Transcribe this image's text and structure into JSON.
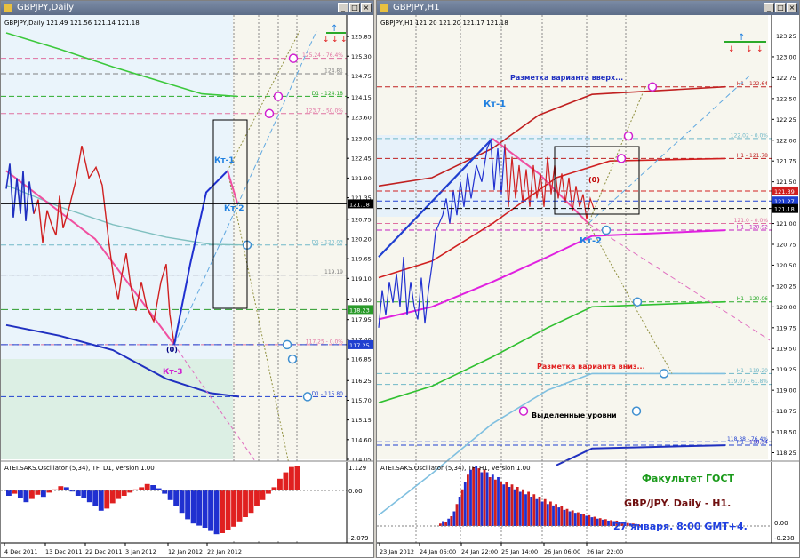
{
  "left_window": {
    "title": "GBPJPY,Daily",
    "header": "GBPJPY,Daily  121.49 121.56 121.14 121.18",
    "osc_label": "ATEI.SAKS.Oscillator (5,34), TF: D1, version 1.00",
    "osc_top": "1.129",
    "osc_mid": "0.00",
    "osc_bottom": "-2.079"
  },
  "right_window": {
    "title": "GBPJPY,H1",
    "header": "GBPJPY,H1  121.20 121.20 121.17 121.18",
    "osc_label": "ATEI.SAKS.Oscillator (5,34), TF: H1, version 1.00",
    "osc_mid": "0.00",
    "osc_bottom": "-0.238"
  },
  "window_buttons": {
    "min": "_",
    "max": "□",
    "close": "×"
  },
  "annotations": {
    "kt1": "Кт-1",
    "kt2": "Кт-2",
    "kt3": "Кт-3",
    "zero": "(0)",
    "up_variant": "Разметка варианта вверх...",
    "down_variant": "Разметка варианта вниз...",
    "levels": "Выделенные уровни",
    "faculty": "Факультет ГОСТ",
    "pair": "GBP/JPY. Daily - H1.",
    "date": "27 января. 8:00 GMT+4."
  },
  "chart_data": [
    {
      "type": "line",
      "title": "GBPJPY,Daily",
      "x_ticks": [
        "4 Dec 2011",
        "13 Dec 2011",
        "22 Dec 2011",
        "3 Jan 2012",
        "12 Jan 2012",
        "22 Jan 2012"
      ],
      "y_ticks": [
        "125.85",
        "125.30",
        "124.75",
        "124.15",
        "123.60",
        "123.00",
        "122.45",
        "121.90",
        "121.35",
        "120.75",
        "120.20",
        "119.65",
        "119.10",
        "118.50",
        "117.95",
        "117.40",
        "116.85",
        "116.25",
        "115.70",
        "115.15",
        "114.60",
        "114.05"
      ],
      "ylim": [
        114.05,
        126.05
      ],
      "current_price": "121.18",
      "price_badges": [
        {
          "label": "121.18",
          "value": 121.18,
          "color": "#000000"
        },
        {
          "label": "118.23",
          "value": 118.23,
          "color": "#2a9a2a"
        },
        {
          "label": "117.25",
          "value": 117.25,
          "color": "#2040d0"
        }
      ],
      "levels": [
        {
          "label": "125.24 - 76.4%",
          "value": 125.24,
          "color": "#e070a0"
        },
        {
          "label": "124.81",
          "value": 124.81,
          "color": "#808080"
        },
        {
          "label": "D1 - 124.18",
          "value": 124.18,
          "color": "#2aaa2a"
        },
        {
          "label": "123.7 - 50.0%",
          "value": 123.7,
          "color": "#e070a0"
        },
        {
          "label": "D1 - 120.03",
          "value": 120.03,
          "color": "#70b8c8"
        },
        {
          "label": "119.19",
          "value": 119.19,
          "color": "#808080"
        },
        {
          "label": "117.25 - 0.0%",
          "value": 117.25,
          "color": "#e070a0"
        },
        {
          "label": "D1 - 115.80",
          "value": 115.8,
          "color": "#2040d0"
        }
      ],
      "price_path": [
        [
          0,
          121.6
        ],
        [
          4,
          122.3
        ],
        [
          8,
          120.8
        ],
        [
          12,
          121.9
        ],
        [
          16,
          120.9
        ],
        [
          19,
          122.1
        ],
        [
          22,
          120.7
        ],
        [
          26,
          121.8
        ],
        [
          31,
          120.9
        ],
        [
          36,
          121.3
        ],
        [
          41,
          120.1
        ],
        [
          46,
          121.0
        ],
        [
          51,
          120.6
        ],
        [
          56,
          120.3
        ],
        [
          60,
          121.4
        ],
        [
          64,
          120.5
        ],
        [
          70,
          121.0
        ],
        [
          78,
          121.8
        ],
        [
          85,
          122.8
        ],
        [
          93,
          121.9
        ],
        [
          101,
          122.2
        ],
        [
          108,
          121.7
        ],
        [
          116,
          120.0
        ],
        [
          121,
          119.1
        ],
        [
          126,
          118.5
        ],
        [
          130,
          119.2
        ],
        [
          135,
          119.8
        ],
        [
          140,
          118.9
        ],
        [
          146,
          118.2
        ],
        [
          152,
          119.0
        ],
        [
          158,
          118.3
        ],
        [
          166,
          117.9
        ],
        [
          174,
          119.0
        ],
        [
          180,
          119.5
        ],
        [
          184,
          118.1
        ],
        [
          189,
          117.25
        ]
      ],
      "up_path": [
        [
          189,
          117.25
        ],
        [
          207,
          119.5
        ],
        [
          225,
          121.5
        ],
        [
          249,
          122.1
        ]
      ],
      "down_path": [
        [
          249,
          122.1
        ],
        [
          260,
          121.2
        ]
      ],
      "ma_green": [
        [
          0,
          125.95
        ],
        [
          60,
          125.5
        ],
        [
          120,
          125.0
        ],
        [
          180,
          124.55
        ],
        [
          220,
          124.25
        ],
        [
          260,
          124.18
        ]
      ],
      "ma_teal": [
        [
          0,
          121.7
        ],
        [
          60,
          121.1
        ],
        [
          120,
          120.6
        ],
        [
          180,
          120.25
        ],
        [
          230,
          120.05
        ],
        [
          275,
          120.03
        ]
      ],
      "ma_blue": [
        [
          0,
          117.8
        ],
        [
          60,
          117.5
        ],
        [
          120,
          117.1
        ],
        [
          180,
          116.3
        ],
        [
          230,
          115.9
        ],
        [
          262,
          115.8
        ]
      ],
      "osc_values": [
        -0.25,
        -0.15,
        -0.35,
        -0.55,
        -0.4,
        -0.2,
        -0.3,
        -0.1,
        0.05,
        0.2,
        0.15,
        -0.05,
        -0.25,
        -0.35,
        -0.55,
        -0.75,
        -0.95,
        -0.85,
        -0.6,
        -0.4,
        -0.25,
        -0.1,
        0.05,
        0.15,
        0.3,
        0.25,
        0.1,
        -0.15,
        -0.45,
        -0.75,
        -1.05,
        -1.35,
        -1.55,
        -1.65,
        -1.75,
        -1.9,
        -2.05,
        -2.0,
        -1.85,
        -1.7,
        -1.45,
        -1.25,
        -1.05,
        -0.75,
        -0.45,
        -0.15,
        0.15,
        0.55,
        0.85,
        1.1,
        1.129
      ]
    },
    {
      "type": "line",
      "title": "GBPJPY,H1",
      "x_ticks": [
        "23 Jan 2012",
        "24 Jan 06:00",
        "24 Jan 22:00",
        "25 Jan 14:00",
        "26 Jan 06:00",
        "26 Jan 22:00"
      ],
      "y_ticks": [
        "123.25",
        "123.00",
        "122.75",
        "122.50",
        "122.25",
        "122.00",
        "121.75",
        "121.50",
        "121.25",
        "121.00",
        "120.75",
        "120.50",
        "120.25",
        "120.00",
        "119.75",
        "119.50",
        "119.25",
        "119.00",
        "118.75",
        "118.50",
        "118.25"
      ],
      "ylim": [
        118.17,
        123.33
      ],
      "price_badges": [
        {
          "label": "121.39",
          "value": 121.39,
          "color": "#d02020"
        },
        {
          "label": "121.27",
          "value": 121.27,
          "color": "#2040d0"
        },
        {
          "label": "121.18",
          "value": 121.18,
          "color": "#000000"
        }
      ],
      "levels": [
        {
          "label": "H1 - 122.64",
          "value": 122.64,
          "color": "#c02020"
        },
        {
          "label": "122.02 - 0.0%",
          "value": 122.02,
          "color": "#70b8c8"
        },
        {
          "label": "H1 - 121.78",
          "value": 121.78,
          "color": "#c02020"
        },
        {
          "label": "121.0 - 0.0%",
          "value": 121.0,
          "color": "#e070a0"
        },
        {
          "label": "H1 - 120.92",
          "value": 120.92,
          "color": "#c020c0"
        },
        {
          "label": "H1 - 120.06",
          "value": 120.06,
          "color": "#2aaa2a"
        },
        {
          "label": "H1 - 119.20",
          "value": 119.2,
          "color": "#70b8c8"
        },
        {
          "label": "119.07 - 61.8%",
          "value": 119.07,
          "color": "#70b8c8"
        },
        {
          "label": "118.34",
          "value": 118.34,
          "color": "#c020c0"
        },
        {
          "label": "118.38 - 76.4%",
          "value": 118.38,
          "color": "#2040d0"
        },
        {
          "label": "H1 - 118.34",
          "value": 118.34,
          "color": "#2040d0"
        }
      ],
      "price_path": [
        [
          0,
          119.75
        ],
        [
          4,
          120.2
        ],
        [
          8,
          119.9
        ],
        [
          12,
          120.3
        ],
        [
          16,
          120.05
        ],
        [
          20,
          120.4
        ],
        [
          24,
          120.0
        ],
        [
          28,
          120.6
        ],
        [
          32,
          119.9
        ],
        [
          36,
          120.3
        ],
        [
          40,
          120.0
        ],
        [
          44,
          119.85
        ],
        [
          48,
          120.35
        ],
        [
          52,
          119.8
        ],
        [
          56,
          120.2
        ],
        [
          60,
          120.5
        ],
        [
          64,
          120.9
        ],
        [
          68,
          121.0
        ],
        [
          72,
          121.1
        ],
        [
          76,
          121.3
        ],
        [
          80,
          121.0
        ],
        [
          84,
          121.4
        ],
        [
          88,
          121.1
        ],
        [
          92,
          121.5
        ],
        [
          96,
          121.2
        ],
        [
          100,
          121.6
        ],
        [
          104,
          121.3
        ],
        [
          110,
          121.7
        ],
        [
          116,
          121.5
        ],
        [
          122,
          121.9
        ],
        [
          126,
          122.0
        ],
        [
          130,
          121.4
        ],
        [
          134,
          121.9
        ],
        [
          138,
          121.35
        ],
        [
          142,
          121.95
        ],
        [
          146,
          121.2
        ],
        [
          150,
          121.8
        ],
        [
          154,
          121.3
        ],
        [
          158,
          121.7
        ],
        [
          162,
          121.25
        ],
        [
          166,
          121.65
        ],
        [
          170,
          121.2
        ],
        [
          174,
          121.7
        ],
        [
          178,
          121.3
        ],
        [
          182,
          121.6
        ],
        [
          186,
          121.2
        ],
        [
          190,
          121.8
        ],
        [
          194,
          121.35
        ],
        [
          198,
          121.7
        ],
        [
          202,
          121.3
        ],
        [
          206,
          121.6
        ],
        [
          210,
          121.25
        ],
        [
          214,
          121.55
        ],
        [
          218,
          121.15
        ],
        [
          222,
          121.45
        ],
        [
          226,
          121.2
        ],
        [
          230,
          121.35
        ],
        [
          234,
          121.05
        ],
        [
          238,
          121.3
        ],
        [
          242,
          121.18
        ]
      ],
      "blue_leg": [
        [
          0,
          120.9
        ],
        [
          40,
          121.3
        ],
        [
          80,
          121.7
        ],
        [
          128,
          122.02
        ]
      ],
      "pink_leg": [
        [
          128,
          122.02
        ],
        [
          180,
          121.6
        ],
        [
          236,
          121.0
        ]
      ],
      "ma_red_top": [
        [
          0,
          121.45
        ],
        [
          60,
          121.55
        ],
        [
          128,
          121.9
        ],
        [
          180,
          122.3
        ],
        [
          240,
          122.55
        ],
        [
          390,
          122.64
        ]
      ],
      "ma_red_mid": [
        [
          0,
          120.35
        ],
        [
          60,
          120.55
        ],
        [
          128,
          121.0
        ],
        [
          200,
          121.55
        ],
        [
          260,
          121.75
        ],
        [
          390,
          121.78
        ]
      ],
      "ma_magenta": [
        [
          0,
          119.85
        ],
        [
          60,
          120.0
        ],
        [
          128,
          120.3
        ],
        [
          190,
          120.6
        ],
        [
          240,
          120.85
        ],
        [
          390,
          120.92
        ]
      ],
      "ma_green": [
        [
          0,
          118.85
        ],
        [
          60,
          119.05
        ],
        [
          128,
          119.4
        ],
        [
          190,
          119.75
        ],
        [
          240,
          120.0
        ],
        [
          390,
          120.06
        ]
      ],
      "ma_lightblue": [
        [
          0,
          117.5
        ],
        [
          60,
          118.0
        ],
        [
          128,
          118.6
        ],
        [
          190,
          119.0
        ],
        [
          240,
          119.2
        ],
        [
          390,
          119.2
        ]
      ],
      "ma_blue_bottom": [
        [
          200,
          118.1
        ],
        [
          240,
          118.3
        ],
        [
          390,
          118.34
        ]
      ],
      "osc_values": [
        0.05,
        0.1,
        0.08,
        0.15,
        0.2,
        0.3,
        0.45,
        0.6,
        0.75,
        0.9,
        1.05,
        1.15,
        1.2,
        1.22,
        1.18,
        1.1,
        1.15,
        1.1,
        1.0,
        1.05,
        0.95,
        1.0,
        0.9,
        0.85,
        0.9,
        0.8,
        0.85,
        0.75,
        0.8,
        0.7,
        0.75,
        0.65,
        0.7,
        0.6,
        0.65,
        0.55,
        0.6,
        0.5,
        0.55,
        0.45,
        0.5,
        0.42,
        0.45,
        0.38,
        0.4,
        0.33,
        0.35,
        0.3,
        0.32,
        0.27,
        0.28,
        0.24,
        0.25,
        0.21,
        0.22,
        0.18,
        0.19,
        0.15,
        0.16,
        0.13,
        0.14,
        0.11,
        0.12,
        0.1,
        0.11,
        0.09,
        0.08,
        0.07,
        0.06,
        0.05,
        0.05,
        0.04,
        0.03,
        0.02
      ]
    }
  ]
}
